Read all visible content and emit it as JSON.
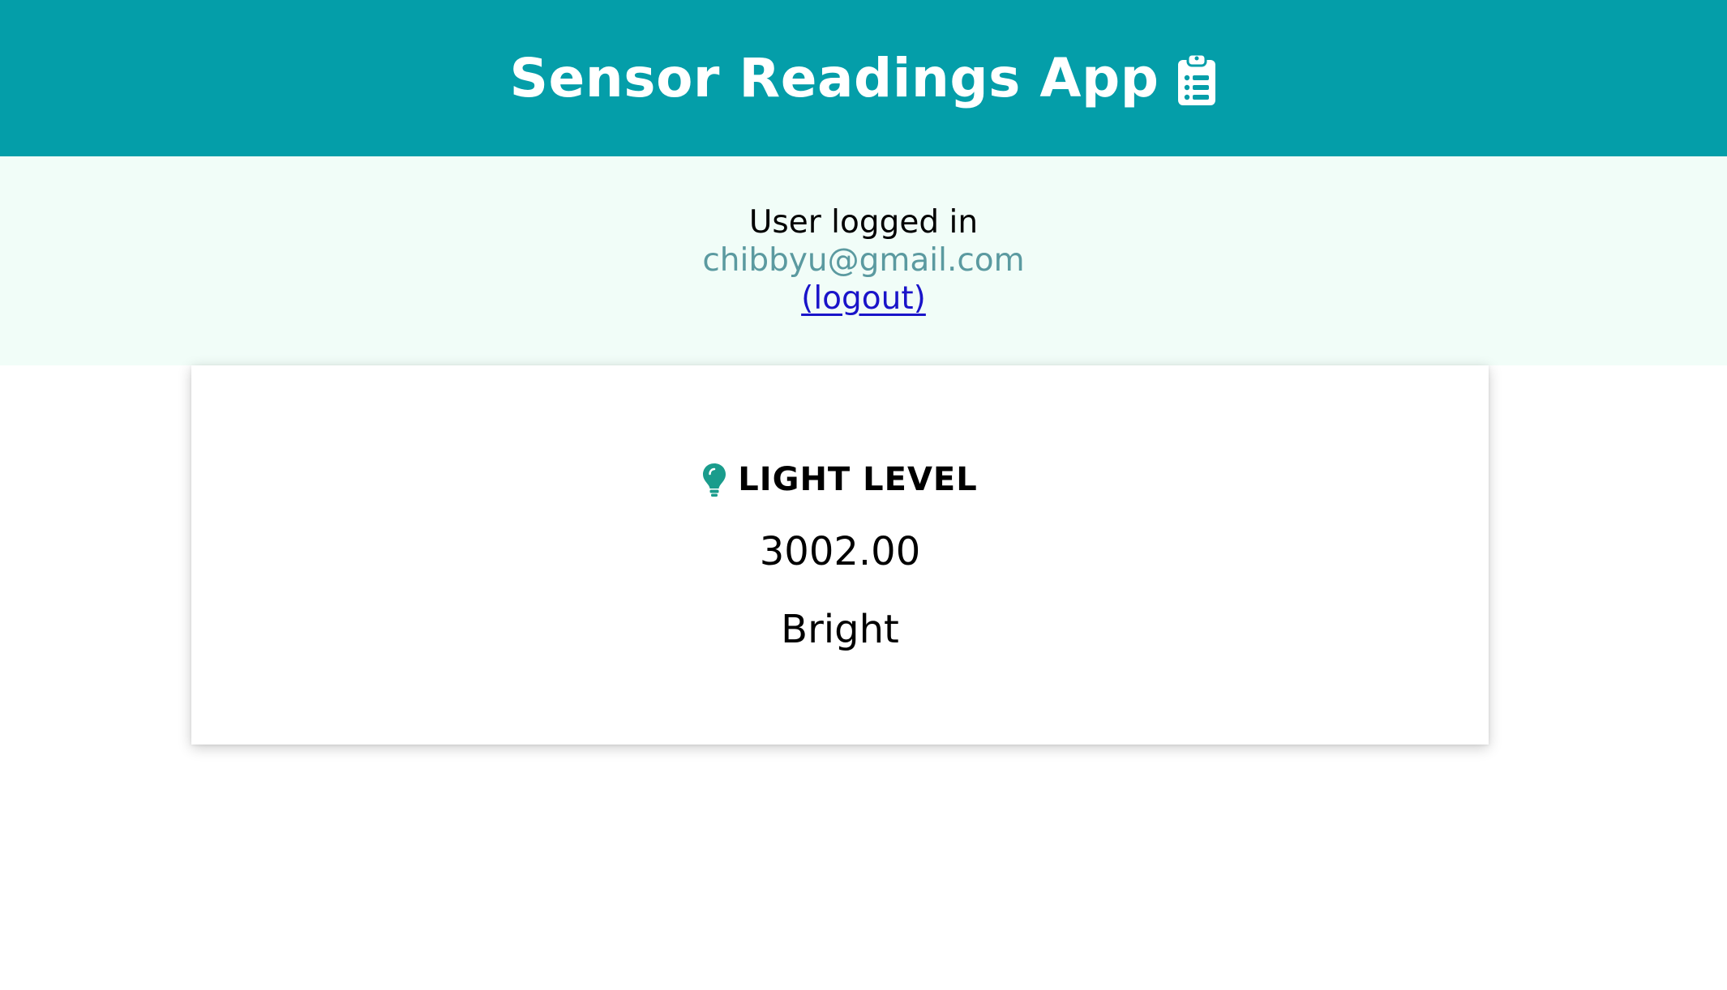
{
  "header": {
    "title": "Sensor Readings App",
    "icon": "clipboard-list-icon",
    "background_color": "#049ea9"
  },
  "auth": {
    "label": "User logged in",
    "email": "chibbyu@gmail.com",
    "logout_label": "(logout)"
  },
  "card": {
    "icon": "lightbulb-icon",
    "icon_color": "#1a9c8c",
    "title": "LIGHT LEVEL",
    "value": "3002.00",
    "status": "Bright"
  }
}
